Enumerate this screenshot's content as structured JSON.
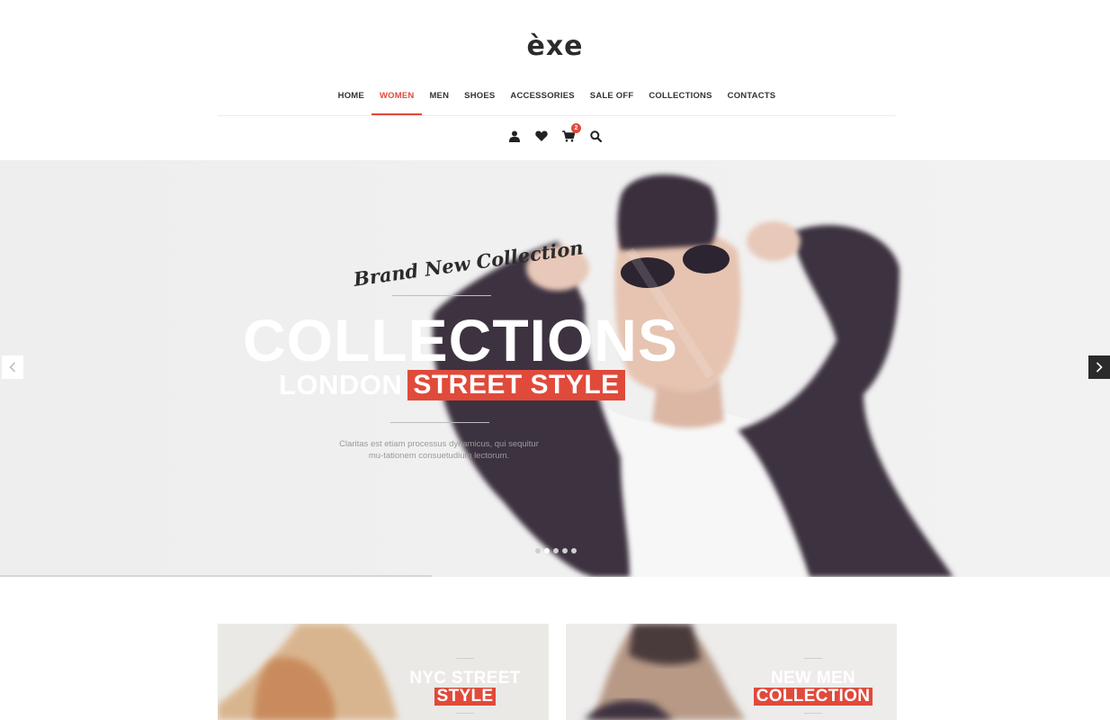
{
  "brand": {
    "logo_text": "èxe"
  },
  "nav": {
    "items": [
      {
        "label": "HOME"
      },
      {
        "label": "WOMEN",
        "active": true
      },
      {
        "label": "MEN"
      },
      {
        "label": "SHOES"
      },
      {
        "label": "ACCESSORIES"
      },
      {
        "label": "SALE OFF"
      },
      {
        "label": "COLLECTIONS"
      },
      {
        "label": "CONTACTS"
      }
    ]
  },
  "header_icons": {
    "account": "user-icon",
    "wishlist": "heart-icon",
    "cart": "cart-icon",
    "cart_count": "2",
    "search": "search-icon"
  },
  "hero": {
    "script_text": "Brand New Collection",
    "title": "COLLECTIONS",
    "sub_white": "LONDON",
    "sub_red": "STREET STYLE",
    "description": "Claritas est etiam processus dynamicus, qui sequitur mu-tationem consuetudium lectorum.",
    "slides_total": 5,
    "active_slide": 2
  },
  "promos": [
    {
      "line1": "NYC STREET",
      "line2": "STYLE"
    },
    {
      "line1": "NEW MEN",
      "line2": "COLLECTION"
    }
  ],
  "colors": {
    "accent": "#e04a3b",
    "text_dark": "#333333",
    "hero_bg": "#efefef",
    "jacket": "#3d3140"
  }
}
